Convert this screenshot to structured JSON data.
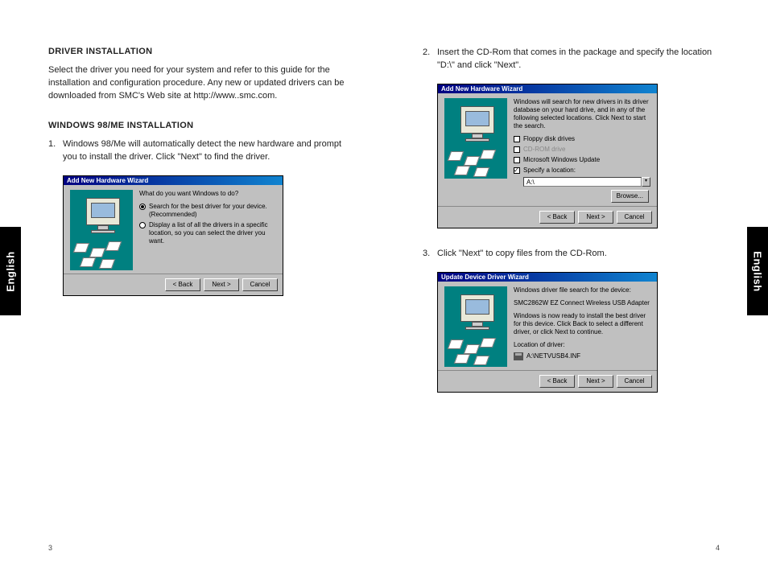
{
  "tabs": {
    "left": "English",
    "right": "English"
  },
  "pageNumbers": {
    "left": "3",
    "right": "4"
  },
  "left": {
    "heading": "DRIVER INSTALLATION",
    "intro": "Select the driver you need for your system and refer to this guide for the installation and configuration procedure. Any new or updated drivers can be downloaded from SMC's Web site at http://www..smc.com.",
    "subheading": "WINDOWS 98/ME INSTALLATION",
    "step1_num": "1.",
    "step1": "Windows 98/Me will automatically detect the new hardware and prompt you to install the driver. Click \"Next\" to find the driver."
  },
  "right": {
    "step2_num": "2.",
    "step2": "Insert the CD-Rom that comes in the package and specify the location \"D:\\\" and click \"Next\".",
    "step3_num": "3.",
    "step3": "Click \"Next\" to copy files from the CD-Rom."
  },
  "wizard1": {
    "title": "Add New Hardware Wizard",
    "prompt": "What do you want Windows to do?",
    "opt1": "Search for the best driver for your device. (Recommended)",
    "opt2": "Display a list of all the drivers in a specific location, so you can select the driver you want.",
    "back": "< Back",
    "next": "Next >",
    "cancel": "Cancel"
  },
  "wizard2": {
    "title": "Add New Hardware Wizard",
    "prompt": "Windows will search for new drivers in its driver database on your hard drive, and in any of the following selected locations. Click Next to start the search.",
    "opt_floppy": "Floppy disk drives",
    "opt_cd": "CD-ROM drive",
    "opt_wu": "Microsoft Windows Update",
    "opt_loc": "Specify a location:",
    "loc_value": "A:\\",
    "browse": "Browse...",
    "back": "< Back",
    "next": "Next >",
    "cancel": "Cancel"
  },
  "wizard3": {
    "title": "Update Device Driver Wizard",
    "line1": "Windows driver file search for the device:",
    "device": "SMC2862W EZ Connect Wireless USB Adapter",
    "line2": "Windows is now ready to install the best driver for this device. Click Back to select a different driver, or click Next to continue.",
    "loc_label": "Location of driver:",
    "loc_value": "A:\\NETVUSB4.INF",
    "back": "< Back",
    "next": "Next >",
    "cancel": "Cancel"
  }
}
